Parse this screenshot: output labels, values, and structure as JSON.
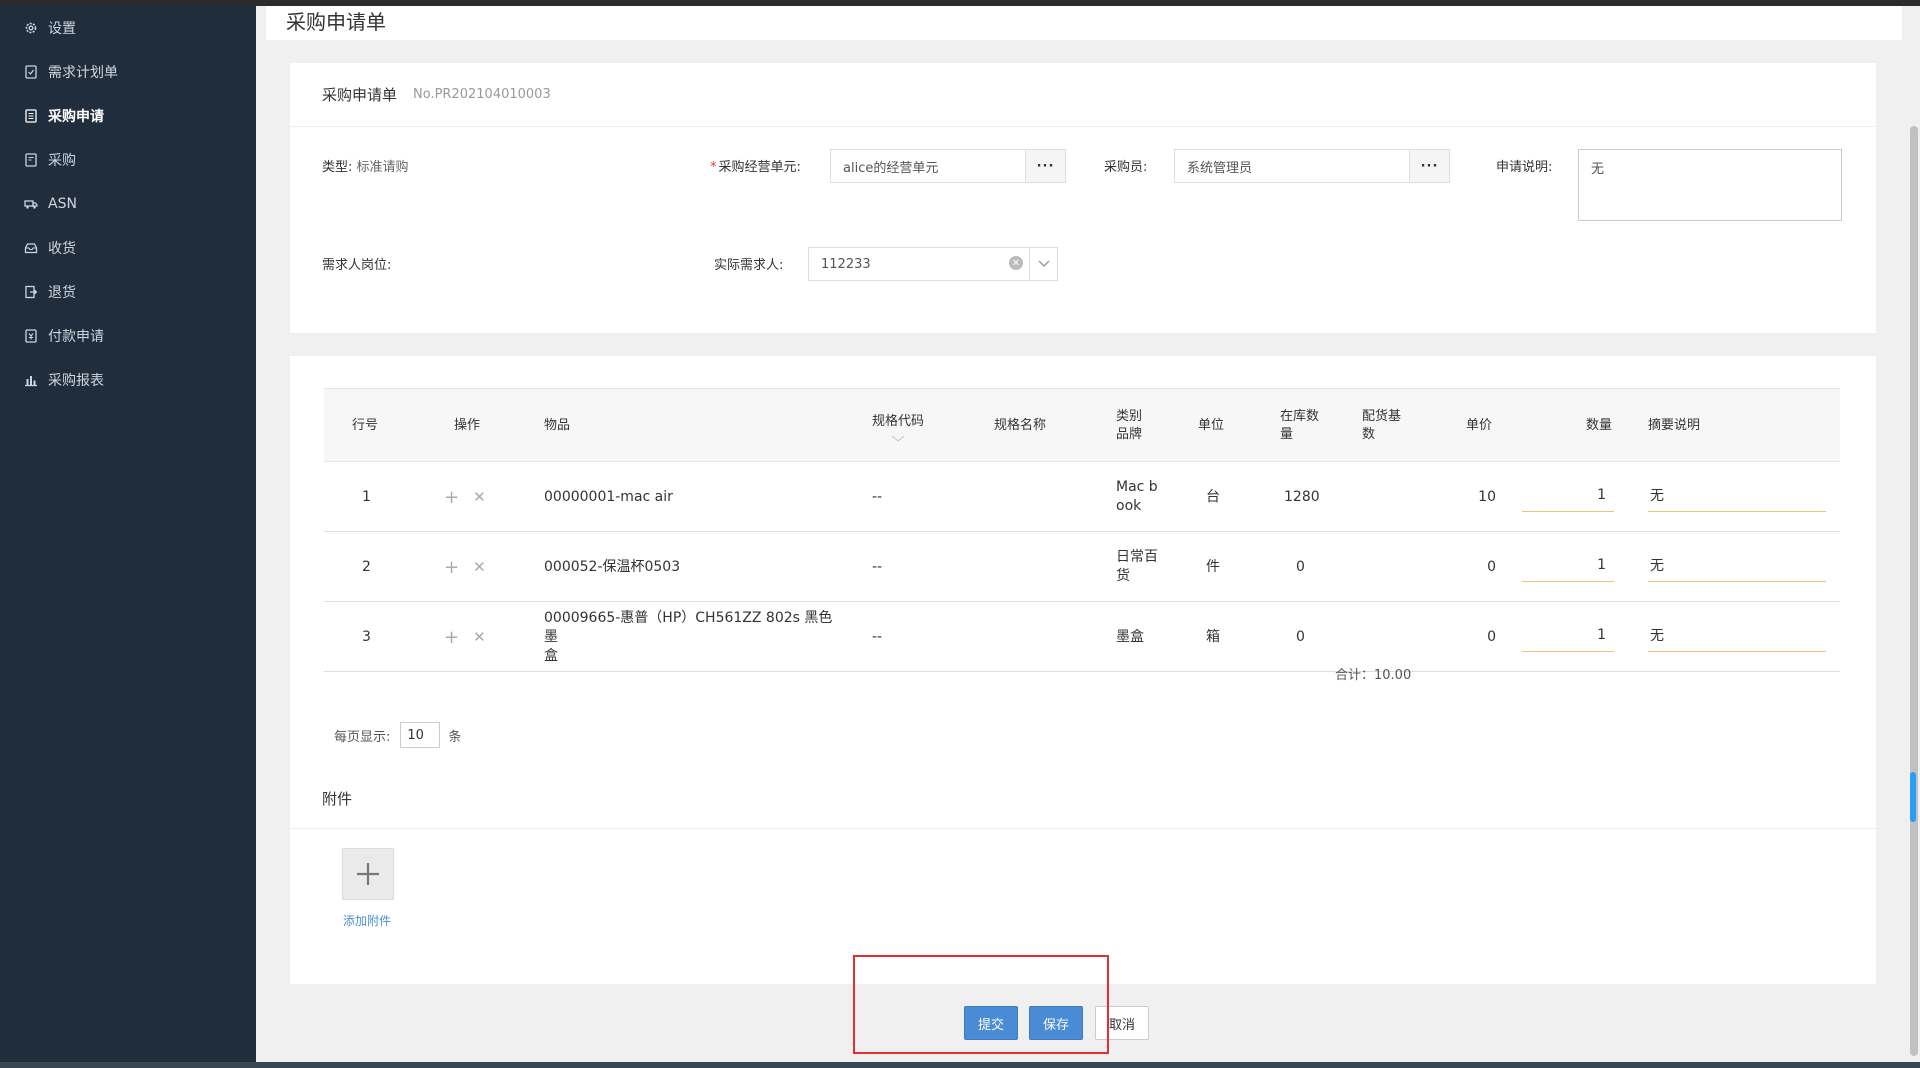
{
  "sidebar": {
    "items": [
      {
        "label": "设置",
        "icon": "gear-icon"
      },
      {
        "label": "需求计划单",
        "icon": "plan-doc-icon"
      },
      {
        "label": "采购申请",
        "icon": "request-doc-icon",
        "active": true
      },
      {
        "label": "采购",
        "icon": "purchase-doc-icon"
      },
      {
        "label": "ASN",
        "icon": "truck-icon"
      },
      {
        "label": "收货",
        "icon": "inbox-icon"
      },
      {
        "label": "退货",
        "icon": "return-icon"
      },
      {
        "label": "付款申请",
        "icon": "payment-icon"
      },
      {
        "label": "采购报表",
        "icon": "bar-chart-icon"
      }
    ]
  },
  "header": {
    "title": "采购申请单"
  },
  "form": {
    "title": "采购申请单",
    "number": "No.PR202104010003",
    "type_label": "类型:",
    "type_value": "标准请购",
    "unit_required": "*",
    "unit_label": "采购经营单元:",
    "unit_value": "alice的经营单元",
    "buyer_label": "采购员:",
    "buyer_value": "系统管理员",
    "desc_label": "申请说明:",
    "desc_value": "无",
    "position_label": "需求人岗位:",
    "requester_label": "实际需求人:",
    "requester_value": "112233",
    "dots": "···"
  },
  "table": {
    "headers": {
      "line": "行号",
      "op": "操作",
      "item": "物品",
      "spec_code": "规格代码",
      "spec_name": "规格名称",
      "category": "类别\n品牌",
      "unit": "单位",
      "stock": "在库数\n量",
      "base_qty": "配货基\n数",
      "price": "单价",
      "qty": "数量",
      "note": "摘要说明"
    },
    "rows": [
      {
        "line": "1",
        "item": "00000001-mac air",
        "spec_code": "--",
        "category": "Mac b\nook",
        "unit": "台",
        "stock": "1280",
        "price": "10",
        "qty": "1",
        "note": "无"
      },
      {
        "line": "2",
        "item": "000052-保温杯0503",
        "spec_code": "--",
        "category": "日常百\n货",
        "unit": "件",
        "stock": "0",
        "price": "0",
        "qty": "1",
        "note": "无"
      },
      {
        "line": "3",
        "item": "00009665-惠普（HP）CH561ZZ 802s 黑色墨\n盒",
        "spec_code": "--",
        "category": "墨盒",
        "unit": "箱",
        "stock": "0",
        "price": "0",
        "qty": "1",
        "note": "无"
      }
    ],
    "total": "合计：10.00"
  },
  "pager": {
    "prefix": "每页显示:",
    "size": "10",
    "suffix": "条"
  },
  "attachment": {
    "title": "附件",
    "add_label": "添加附件"
  },
  "actions": {
    "submit": "提交",
    "save": "保存",
    "cancel": "取消"
  },
  "colors": {
    "sidebar": "#1f2d3d",
    "primary": "#4a8bd6",
    "highlight": "#e03131"
  }
}
